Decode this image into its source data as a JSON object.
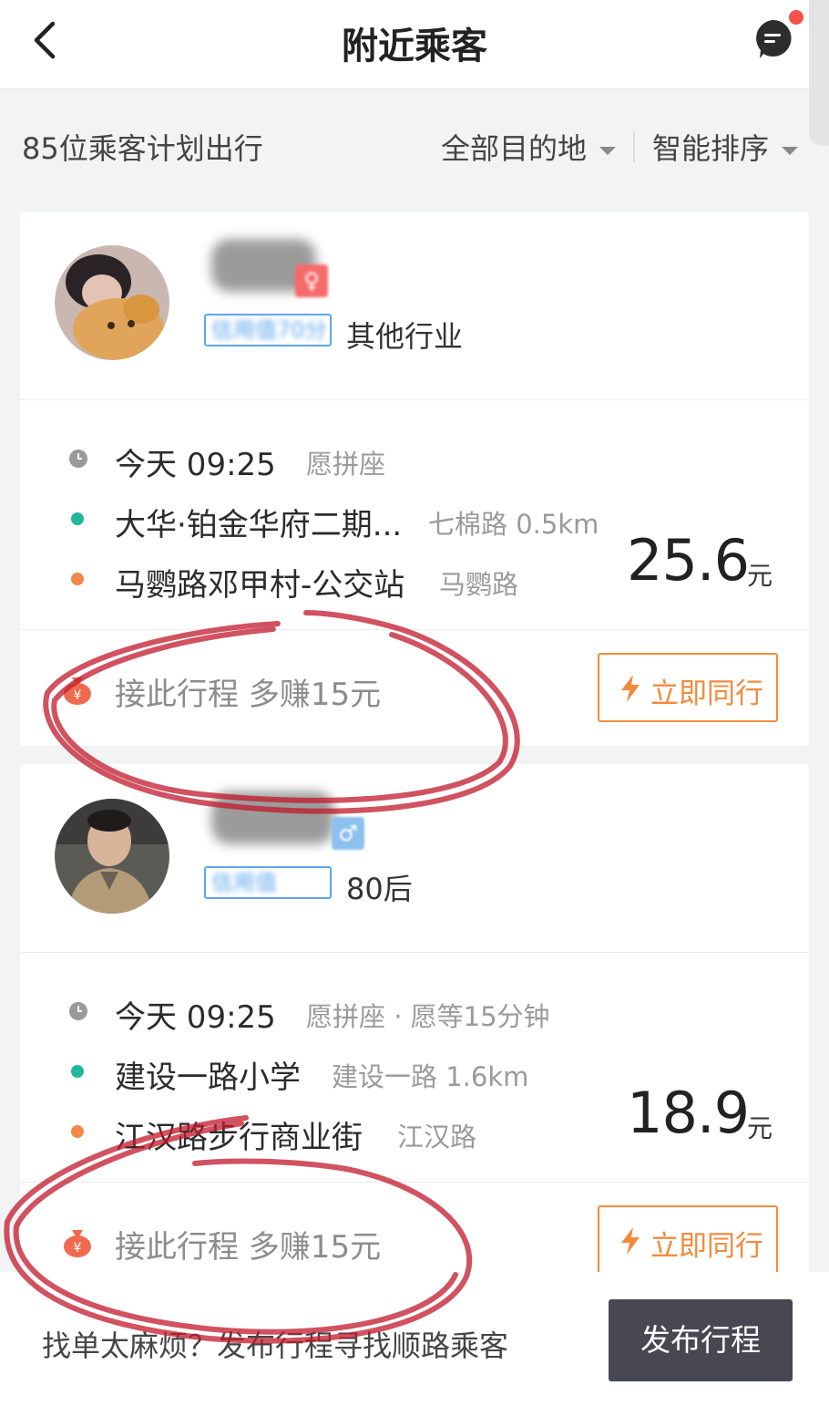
{
  "header": {
    "title": "附近乘客"
  },
  "filter_bar": {
    "count_text": "85位乘客计划出行",
    "destination_filter": "全部目的地",
    "sort_filter": "智能排序"
  },
  "passengers": [
    {
      "badge_text": "信用值70分",
      "gender_symbol": "♀",
      "gender_color": "#f56a6a",
      "tag": "其他行业",
      "time": "今天 09:25",
      "time_note": "愿拼座",
      "origin": "大华·铂金华府二期...",
      "origin_note": "七棉路 0.5km",
      "destination": "马鹦路邓甲村-公交站",
      "destination_note": "马鹦路",
      "price": "25.6",
      "price_unit": "元",
      "bonus_text": "接此行程 多赚15元",
      "action_label": "立即同行"
    },
    {
      "badge_text": "信用值",
      "gender_symbol": "♂",
      "gender_color": "#5ea7ec",
      "tag": "80后",
      "time": "今天 09:25",
      "time_note": "愿拼座 · 愿等15分钟",
      "origin": "建设一路小学",
      "origin_note": "建设一路 1.6km",
      "destination": "江汉路步行商业街",
      "destination_note": "江汉路",
      "price": "18.9",
      "price_unit": "元",
      "bonus_text": "接此行程 多赚15元",
      "action_label": "立即同行"
    }
  ],
  "footer": {
    "prompt_text": "找单太麻烦？发布行程寻找顺路乘客",
    "publish_label": "发布行程"
  },
  "colors": {
    "accent_orange": "#f28b3c",
    "origin_green": "#1fb89a",
    "destination_orange": "#f2894a",
    "publish_button": "#474852",
    "notification_dot": "#f4524d"
  },
  "icons": [
    "back-arrow-icon",
    "message-icon",
    "clock-icon",
    "money-bag-icon",
    "lightning-icon"
  ]
}
